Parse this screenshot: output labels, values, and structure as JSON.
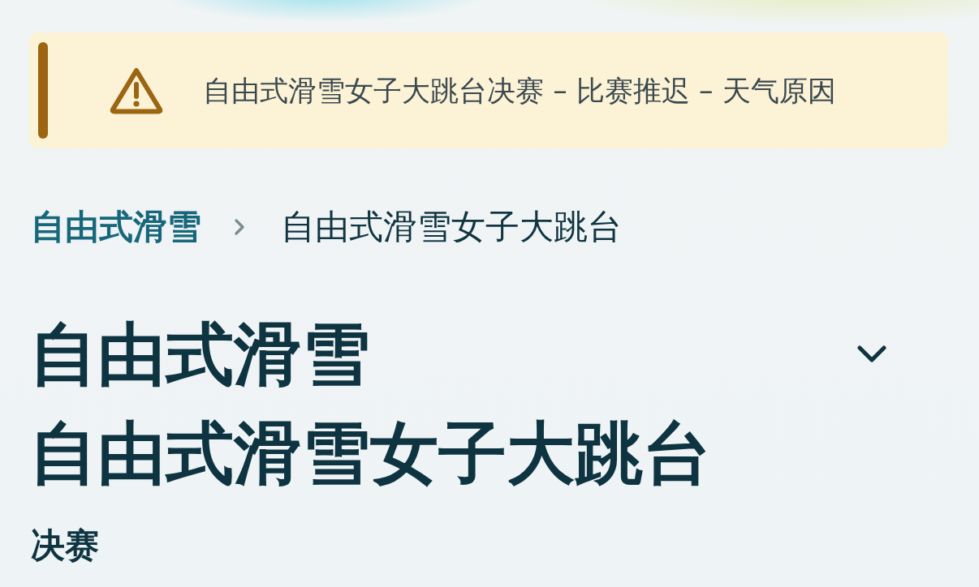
{
  "alert": {
    "kind": "warning",
    "message": "自由式滑雪女子大跳台决赛 – 比赛推迟 – 天气原因"
  },
  "breadcrumb": [
    {
      "label": "自由式滑雪",
      "current": false
    },
    {
      "label": "自由式滑雪女子大跳台",
      "current": true
    }
  ],
  "header": {
    "sport": "自由式滑雪",
    "event": "自由式滑雪女子大跳台",
    "expanded": false
  },
  "phase": "决赛"
}
